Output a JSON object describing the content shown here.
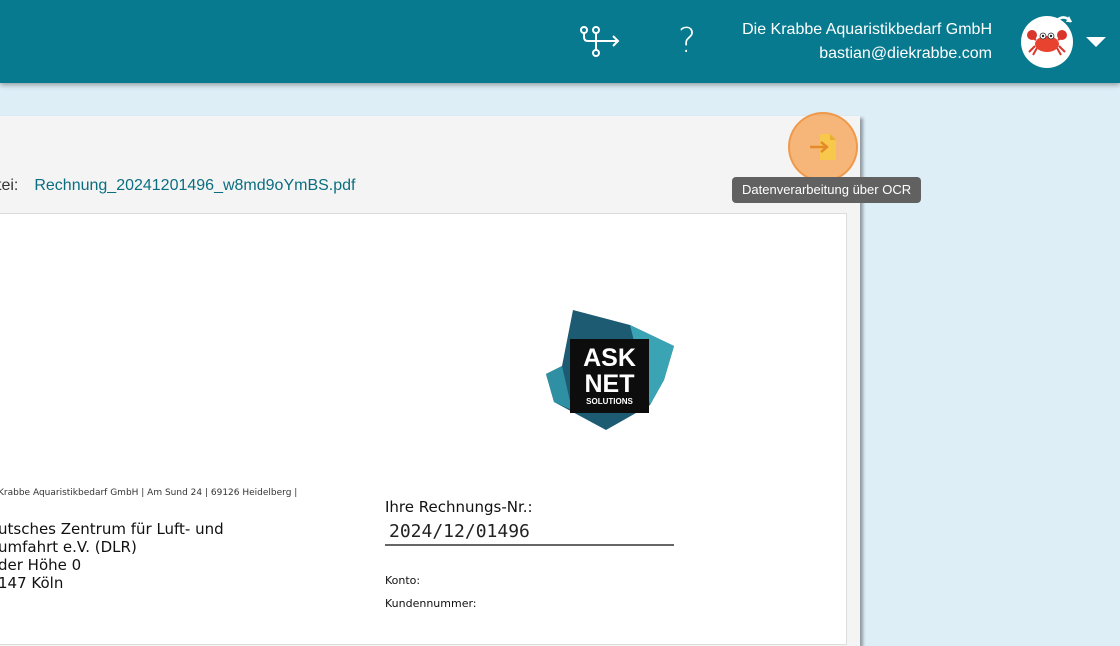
{
  "header": {
    "company_name": "Die Krabbe Aquaristikbedarf GmbH",
    "email": "bastian@diekrabbe.com",
    "help_label": "?",
    "icons": [
      "workflow-icon",
      "help-icon",
      "crab-avatar-icon",
      "chevron-down-icon"
    ]
  },
  "file": {
    "label": "tei:",
    "name": "Rechnung_20241201496_w8md9oYmBS.pdf"
  },
  "ocr": {
    "icon": "file-arrow-right-icon",
    "tooltip": "Datenverarbeitung über OCR"
  },
  "document": {
    "logo": {
      "line1": "ASK",
      "line2": "NET",
      "line3": "SOLUTIONS"
    },
    "sender_line": "Krabbe Aquaristikbedarf GmbH | Am Sund 24 | 69126 Heidelberg |",
    "recipient": [
      "utsches Zentrum für Luft- und",
      "umfahrt e.V. (DLR)",
      "der Höhe 0",
      "147 Köln"
    ],
    "invoice_number_label": "Ihre Rechnungs-Nr.:",
    "invoice_number": "2024/12/01496",
    "konto_label": "Konto:",
    "kundennummer_label": "Kundennummer:"
  },
  "colors": {
    "header_bg": "#077a8f",
    "page_bg": "#deeef7",
    "link": "#0b6e80",
    "ocr_highlight": "#f6a456",
    "tooltip_bg": "#616161"
  }
}
